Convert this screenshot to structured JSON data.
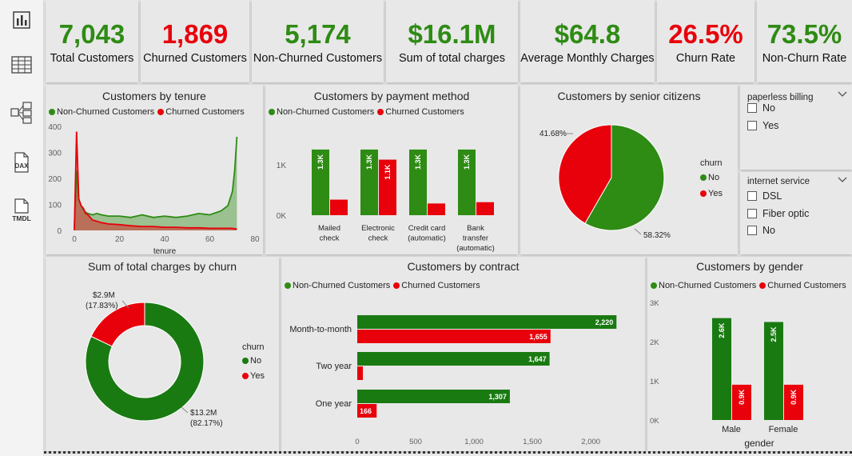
{
  "colors": {
    "green": "#2e8b14",
    "red": "#e8000b",
    "dark_green": "#1a7a12"
  },
  "sidebar": [
    {
      "name": "report-view-icon"
    },
    {
      "name": "table-view-icon"
    },
    {
      "name": "model-view-icon"
    },
    {
      "name": "dax-query-icon",
      "label": "DAX"
    },
    {
      "name": "tmdl-view-icon",
      "label": "TMDL"
    }
  ],
  "kpis": [
    {
      "value": "7,043",
      "label": "Total Customers",
      "color": "green"
    },
    {
      "value": "1,869",
      "label": "Churned Customers",
      "color": "red"
    },
    {
      "value": "5,174",
      "label": "Non-Churned Customers",
      "color": "green"
    },
    {
      "value": "$16.1M",
      "label": "Sum of total charges",
      "color": "green"
    },
    {
      "value": "$64.8",
      "label": "Average Monthly Charges",
      "color": "green"
    },
    {
      "value": "26.5%",
      "label": "Churn Rate",
      "color": "red"
    },
    {
      "value": "73.5%",
      "label": "Non-Churn Rate",
      "color": "green"
    }
  ],
  "tenure": {
    "title": "Customers by tenure",
    "legend": [
      "Non-Churned Customers",
      "Churned Customers"
    ],
    "xlabel": "tenure",
    "x_ticks": [
      "0",
      "20",
      "40",
      "60",
      "80"
    ],
    "y_ticks": [
      "0",
      "100",
      "200",
      "300",
      "400"
    ]
  },
  "payment": {
    "title": "Customers by payment method",
    "legend": [
      "Non-Churned Customers",
      "Churned Customers"
    ],
    "y_ticks": [
      "0K",
      "1K"
    ],
    "categories": [
      [
        "Mailed",
        "check"
      ],
      [
        "Electronic",
        "check"
      ],
      [
        "Credit card",
        "(automatic)"
      ],
      [
        "Bank",
        "transfer",
        "(automatic)"
      ]
    ],
    "bar_labels": [
      "1.3K",
      "1.3K",
      "1.1K",
      "1.3K",
      "1.3K"
    ]
  },
  "senior": {
    "title": "Customers by senior citizens",
    "legend_title": "churn",
    "legend": [
      "No",
      "Yes"
    ],
    "labels": [
      "41.68%",
      "58.32%"
    ]
  },
  "slicer_paperless": {
    "title": "paperless billing",
    "options": [
      "No",
      "Yes"
    ]
  },
  "slicer_internet": {
    "title": "internet service",
    "options": [
      "DSL",
      "Fiber optic",
      "No"
    ]
  },
  "charges": {
    "title": "Sum of total charges by churn",
    "legend_title": "churn",
    "legend": [
      "No",
      "Yes"
    ],
    "label_yes": [
      "$2.9M",
      "(17.83%)"
    ],
    "label_no": [
      "$13.2M",
      "(82.17%)"
    ]
  },
  "contract": {
    "title": "Customers by contract",
    "legend": [
      "Non-Churned Customers",
      "Churned Customers"
    ],
    "categories": [
      "Month-to-month",
      "Two year",
      "One year"
    ],
    "value_labels": [
      "2,220",
      "1,655",
      "1,647",
      "1,307",
      "166"
    ],
    "x_ticks": [
      "0",
      "500",
      "1,000",
      "1,500",
      "2,000"
    ]
  },
  "gender": {
    "title": "Customers by gender",
    "legend": [
      "Non-Churned Customers",
      "Churned Customers"
    ],
    "y_ticks": [
      "0K",
      "1K",
      "2K",
      "3K"
    ],
    "categories": [
      "Male",
      "Female"
    ],
    "bar_labels": [
      "2.6K",
      "0.9K",
      "2.5K",
      "0.9K"
    ],
    "xlabel": "gender"
  },
  "chart_data": [
    {
      "type": "area",
      "title": "Customers by tenure",
      "xlabel": "tenure",
      "ylim": [
        0,
        400
      ],
      "xlim": [
        0,
        80
      ],
      "x": [
        0,
        1,
        2,
        3,
        4,
        5,
        6,
        8,
        10,
        12,
        15,
        20,
        25,
        30,
        35,
        40,
        45,
        50,
        55,
        60,
        65,
        68,
        70,
        71,
        72
      ],
      "series": [
        {
          "name": "Non-Churned Customers",
          "values": [
            10,
            230,
            120,
            95,
            80,
            70,
            65,
            60,
            65,
            60,
            55,
            55,
            50,
            60,
            50,
            55,
            50,
            55,
            65,
            60,
            75,
            95,
            150,
            230,
            360
          ]
        },
        {
          "name": "Churned Customers",
          "values": [
            0,
            380,
            120,
            95,
            85,
            65,
            60,
            40,
            35,
            30,
            25,
            22,
            18,
            15,
            15,
            12,
            12,
            10,
            10,
            8,
            8,
            8,
            8,
            6,
            6
          ]
        }
      ]
    },
    {
      "type": "bar",
      "title": "Customers by payment method",
      "categories": [
        "Mailed check",
        "Electronic check",
        "Credit card (automatic)",
        "Bank transfer (automatic)"
      ],
      "ylim": [
        0,
        1600
      ],
      "series": [
        {
          "name": "Non-Churned Customers",
          "values": [
            1300,
            1300,
            1300,
            1300
          ]
        },
        {
          "name": "Churned Customers",
          "values": [
            308,
            1100,
            232,
            258
          ]
        }
      ]
    },
    {
      "type": "pie",
      "title": "Customers by senior citizens",
      "categories": [
        "No",
        "Yes"
      ],
      "values": [
        58.32,
        41.68
      ]
    },
    {
      "type": "pie",
      "title": "Sum of total charges by churn",
      "categories": [
        "No",
        "Yes"
      ],
      "values": [
        13.2,
        2.9
      ],
      "percent": [
        82.17,
        17.83
      ]
    },
    {
      "type": "bar",
      "title": "Customers by contract",
      "categories": [
        "Month-to-month",
        "Two year",
        "One year"
      ],
      "xlim": [
        0,
        2300
      ],
      "series": [
        {
          "name": "Non-Churned Customers",
          "values": [
            2220,
            1647,
            1307
          ]
        },
        {
          "name": "Churned Customers",
          "values": [
            1655,
            48,
            166
          ]
        }
      ]
    },
    {
      "type": "bar",
      "title": "Customers by gender",
      "xlabel": "gender",
      "categories": [
        "Male",
        "Female"
      ],
      "ylim": [
        0,
        3000
      ],
      "series": [
        {
          "name": "Non-Churned Customers",
          "values": [
            2600,
            2500
          ]
        },
        {
          "name": "Churned Customers",
          "values": [
            900,
            900
          ]
        }
      ]
    }
  ]
}
